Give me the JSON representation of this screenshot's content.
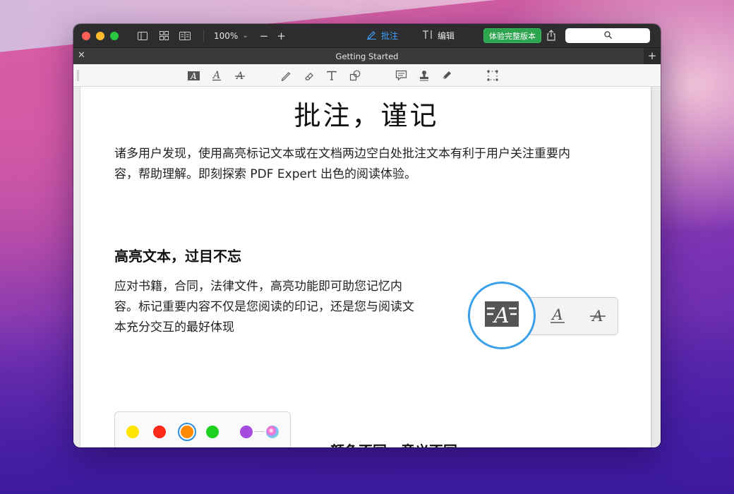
{
  "window": {
    "zoom": "100%",
    "modes": [
      {
        "label": "批注",
        "icon": "pen-icon",
        "active": true
      },
      {
        "label": "编辑",
        "icon": "text-cursor-icon",
        "active": false
      }
    ],
    "trial_button": "体验完整版本",
    "tab_title": "Getting Started"
  },
  "document": {
    "title": "批注，谨记",
    "intro_line1": "诸多用户发现，使用高亮标记文本或在文档两边空白处批注文本有利于用户关注重要内",
    "intro_line2": "容，帮助理解。即刻探索 PDF Expert 出色的阅读体验。",
    "section1_heading": "高亮文本，过目不忘",
    "section1_line1": "应对书籍，合同，法律文件，高亮功能即可助您记忆内",
    "section1_line2": "容。标记重要内容不仅是您阅读的印记，还是您与阅读文",
    "section1_line3": "本充分交互的最好体现",
    "section2_heading_partial": "颜色不同，意义不同"
  },
  "colors": {
    "palette": [
      "#ffe600",
      "#ff2a1a",
      "#ff8a00",
      "#1fd11f",
      "#a64bdf"
    ],
    "accent": "#3aa0e8",
    "trial_green": "#2da44e"
  }
}
